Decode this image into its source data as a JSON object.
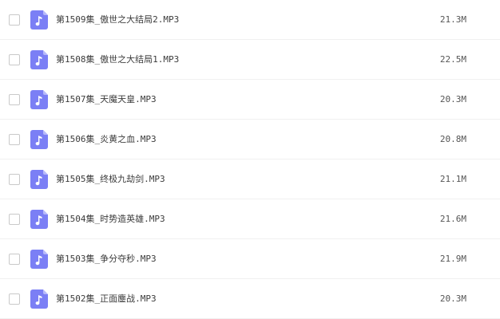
{
  "files": [
    {
      "name": "第1509集_傲世之大结局2.MP3",
      "size": "21.3M",
      "icon": "audio-file-icon"
    },
    {
      "name": "第1508集_傲世之大结局1.MP3",
      "size": "22.5M",
      "icon": "audio-file-icon"
    },
    {
      "name": "第1507集_天魔天皇.MP3",
      "size": "20.3M",
      "icon": "audio-file-icon"
    },
    {
      "name": "第1506集_炎黄之血.MP3",
      "size": "20.8M",
      "icon": "audio-file-icon"
    },
    {
      "name": "第1505集_终极九劫剑.MP3",
      "size": "21.1M",
      "icon": "audio-file-icon"
    },
    {
      "name": "第1504集_时势造英雄.MP3",
      "size": "21.6M",
      "icon": "audio-file-icon"
    },
    {
      "name": "第1503集_争分夺秒.MP3",
      "size": "21.9M",
      "icon": "audio-file-icon"
    },
    {
      "name": "第1502集_正面鏖战.MP3",
      "size": "20.3M",
      "icon": "audio-file-icon"
    }
  ],
  "colors": {
    "icon_bg": "#7b7ff5",
    "icon_fold": "#b7b9fa",
    "row_border": "#f0f0f0",
    "checkbox_border": "#c9c9c9"
  }
}
